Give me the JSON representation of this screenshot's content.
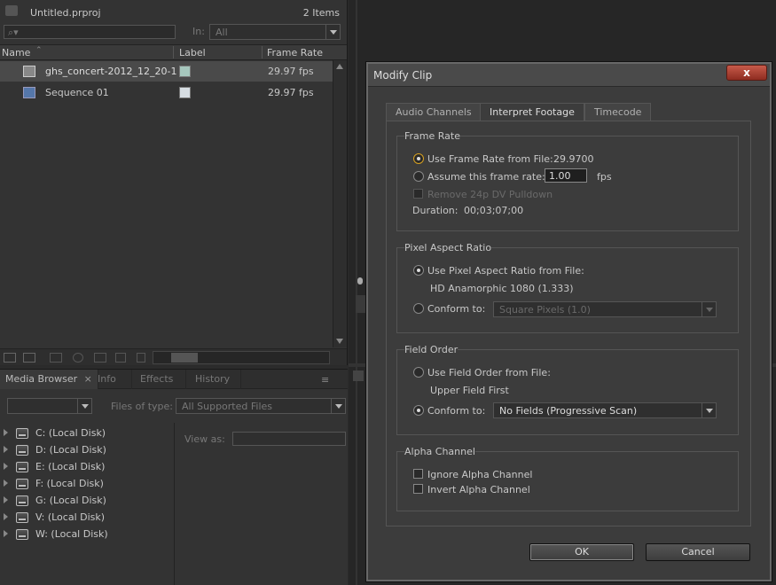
{
  "project": {
    "filename": "Untitled.prproj",
    "item_count": "2 Items",
    "search_placeholder": "",
    "in_label": "In:",
    "in_value": "All",
    "columns": [
      "Name",
      "Label",
      "Frame Rate"
    ],
    "items": [
      {
        "name": "ghs_concert-2012_12_20-1",
        "frame_rate": "29.97 fps",
        "label_color": "#a6c7bd"
      },
      {
        "name": "Sequence 01",
        "frame_rate": "29.97 fps",
        "label_color": "#d6dde2"
      }
    ]
  },
  "media": {
    "tabs": [
      "Media Browser",
      "Info",
      "Effects",
      "History"
    ],
    "files_of_type_label": "Files of type:",
    "files_of_type_value": "All Supported Files",
    "view_as_label": "View as:",
    "drives": [
      "C: (Local Disk)",
      "D: (Local Disk)",
      "E: (Local Disk)",
      "F: (Local Disk)",
      "G: (Local Disk)",
      "V: (Local Disk)",
      "W: (Local Disk)"
    ]
  },
  "dialog": {
    "title": "Modify Clip",
    "close": "x",
    "tabs": [
      "Audio Channels",
      "Interpret Footage",
      "Timecode"
    ],
    "frame_rate": {
      "title": "Frame Rate",
      "use_from_file": "Use Frame Rate from File:",
      "file_value": "29.9700",
      "assume": "Assume this frame rate:",
      "assume_value": "1.00",
      "fps": "fps",
      "remove_pulldown": "Remove 24p DV Pulldown",
      "duration_label": "Duration:",
      "duration_value": "00;03;07;00"
    },
    "par": {
      "title": "Pixel Aspect Ratio",
      "use_from_file": "Use Pixel Aspect Ratio from File:",
      "file_value": "HD Anamorphic 1080 (1.333)",
      "conform": "Conform to:",
      "conform_value": "Square Pixels (1.0)"
    },
    "field_order": {
      "title": "Field Order",
      "use_from_file": "Use Field Order from File:",
      "file_value": "Upper Field First",
      "conform": "Conform to:",
      "conform_value": "No Fields (Progressive Scan)"
    },
    "alpha": {
      "title": "Alpha Channel",
      "ignore": "Ignore Alpha Channel",
      "invert": "Invert Alpha Channel"
    },
    "ok": "OK",
    "cancel": "Cancel"
  }
}
